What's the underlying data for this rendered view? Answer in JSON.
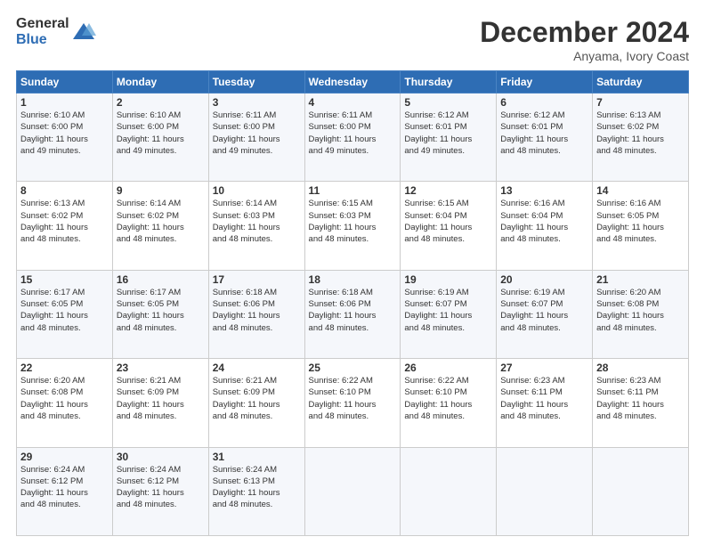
{
  "logo": {
    "general": "General",
    "blue": "Blue"
  },
  "title": "December 2024",
  "subtitle": "Anyama, Ivory Coast",
  "days_header": [
    "Sunday",
    "Monday",
    "Tuesday",
    "Wednesday",
    "Thursday",
    "Friday",
    "Saturday"
  ],
  "weeks": [
    [
      {
        "day": "1",
        "info": "Sunrise: 6:10 AM\nSunset: 6:00 PM\nDaylight: 11 hours\nand 49 minutes."
      },
      {
        "day": "2",
        "info": "Sunrise: 6:10 AM\nSunset: 6:00 PM\nDaylight: 11 hours\nand 49 minutes."
      },
      {
        "day": "3",
        "info": "Sunrise: 6:11 AM\nSunset: 6:00 PM\nDaylight: 11 hours\nand 49 minutes."
      },
      {
        "day": "4",
        "info": "Sunrise: 6:11 AM\nSunset: 6:00 PM\nDaylight: 11 hours\nand 49 minutes."
      },
      {
        "day": "5",
        "info": "Sunrise: 6:12 AM\nSunset: 6:01 PM\nDaylight: 11 hours\nand 49 minutes."
      },
      {
        "day": "6",
        "info": "Sunrise: 6:12 AM\nSunset: 6:01 PM\nDaylight: 11 hours\nand 48 minutes."
      },
      {
        "day": "7",
        "info": "Sunrise: 6:13 AM\nSunset: 6:02 PM\nDaylight: 11 hours\nand 48 minutes."
      }
    ],
    [
      {
        "day": "8",
        "info": "Sunrise: 6:13 AM\nSunset: 6:02 PM\nDaylight: 11 hours\nand 48 minutes."
      },
      {
        "day": "9",
        "info": "Sunrise: 6:14 AM\nSunset: 6:02 PM\nDaylight: 11 hours\nand 48 minutes."
      },
      {
        "day": "10",
        "info": "Sunrise: 6:14 AM\nSunset: 6:03 PM\nDaylight: 11 hours\nand 48 minutes."
      },
      {
        "day": "11",
        "info": "Sunrise: 6:15 AM\nSunset: 6:03 PM\nDaylight: 11 hours\nand 48 minutes."
      },
      {
        "day": "12",
        "info": "Sunrise: 6:15 AM\nSunset: 6:04 PM\nDaylight: 11 hours\nand 48 minutes."
      },
      {
        "day": "13",
        "info": "Sunrise: 6:16 AM\nSunset: 6:04 PM\nDaylight: 11 hours\nand 48 minutes."
      },
      {
        "day": "14",
        "info": "Sunrise: 6:16 AM\nSunset: 6:05 PM\nDaylight: 11 hours\nand 48 minutes."
      }
    ],
    [
      {
        "day": "15",
        "info": "Sunrise: 6:17 AM\nSunset: 6:05 PM\nDaylight: 11 hours\nand 48 minutes."
      },
      {
        "day": "16",
        "info": "Sunrise: 6:17 AM\nSunset: 6:05 PM\nDaylight: 11 hours\nand 48 minutes."
      },
      {
        "day": "17",
        "info": "Sunrise: 6:18 AM\nSunset: 6:06 PM\nDaylight: 11 hours\nand 48 minutes."
      },
      {
        "day": "18",
        "info": "Sunrise: 6:18 AM\nSunset: 6:06 PM\nDaylight: 11 hours\nand 48 minutes."
      },
      {
        "day": "19",
        "info": "Sunrise: 6:19 AM\nSunset: 6:07 PM\nDaylight: 11 hours\nand 48 minutes."
      },
      {
        "day": "20",
        "info": "Sunrise: 6:19 AM\nSunset: 6:07 PM\nDaylight: 11 hours\nand 48 minutes."
      },
      {
        "day": "21",
        "info": "Sunrise: 6:20 AM\nSunset: 6:08 PM\nDaylight: 11 hours\nand 48 minutes."
      }
    ],
    [
      {
        "day": "22",
        "info": "Sunrise: 6:20 AM\nSunset: 6:08 PM\nDaylight: 11 hours\nand 48 minutes."
      },
      {
        "day": "23",
        "info": "Sunrise: 6:21 AM\nSunset: 6:09 PM\nDaylight: 11 hours\nand 48 minutes."
      },
      {
        "day": "24",
        "info": "Sunrise: 6:21 AM\nSunset: 6:09 PM\nDaylight: 11 hours\nand 48 minutes."
      },
      {
        "day": "25",
        "info": "Sunrise: 6:22 AM\nSunset: 6:10 PM\nDaylight: 11 hours\nand 48 minutes."
      },
      {
        "day": "26",
        "info": "Sunrise: 6:22 AM\nSunset: 6:10 PM\nDaylight: 11 hours\nand 48 minutes."
      },
      {
        "day": "27",
        "info": "Sunrise: 6:23 AM\nSunset: 6:11 PM\nDaylight: 11 hours\nand 48 minutes."
      },
      {
        "day": "28",
        "info": "Sunrise: 6:23 AM\nSunset: 6:11 PM\nDaylight: 11 hours\nand 48 minutes."
      }
    ],
    [
      {
        "day": "29",
        "info": "Sunrise: 6:24 AM\nSunset: 6:12 PM\nDaylight: 11 hours\nand 48 minutes."
      },
      {
        "day": "30",
        "info": "Sunrise: 6:24 AM\nSunset: 6:12 PM\nDaylight: 11 hours\nand 48 minutes."
      },
      {
        "day": "31",
        "info": "Sunrise: 6:24 AM\nSunset: 6:13 PM\nDaylight: 11 hours\nand 48 minutes."
      },
      {
        "day": "",
        "info": ""
      },
      {
        "day": "",
        "info": ""
      },
      {
        "day": "",
        "info": ""
      },
      {
        "day": "",
        "info": ""
      }
    ]
  ]
}
